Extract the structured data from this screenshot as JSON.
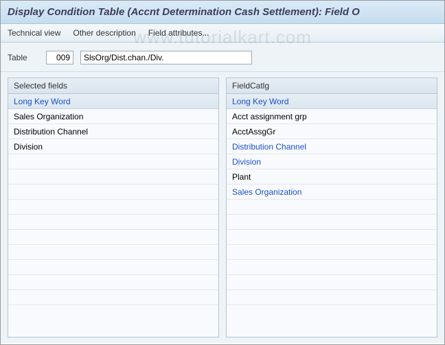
{
  "title": "Display Condition Table (Accnt Determination Cash Settlement): Field O",
  "toolbar": {
    "technical_view": "Technical view",
    "other_description": "Other description",
    "field_attributes": "Field attributes..."
  },
  "table_section": {
    "label": "Table",
    "number": "009",
    "description": "SlsOrg/Dist.chan./Div."
  },
  "selected_fields": {
    "title": "Selected fields",
    "header": "Long Key Word",
    "items": [
      {
        "label": "Sales Organization",
        "link": false
      },
      {
        "label": "Distribution Channel",
        "link": false
      },
      {
        "label": "Division",
        "link": false
      }
    ],
    "empty_rows": 10
  },
  "field_catalog": {
    "title": "FieldCatlg",
    "header": "Long Key Word",
    "items": [
      {
        "label": "Acct assignment grp",
        "link": false
      },
      {
        "label": "AcctAssgGr",
        "link": false
      },
      {
        "label": "Distribution Channel",
        "link": true
      },
      {
        "label": "Division",
        "link": true
      },
      {
        "label": "Plant",
        "link": false
      },
      {
        "label": "Sales Organization",
        "link": true
      }
    ],
    "empty_rows": 7
  },
  "watermark": "www.tutorialkart.com"
}
